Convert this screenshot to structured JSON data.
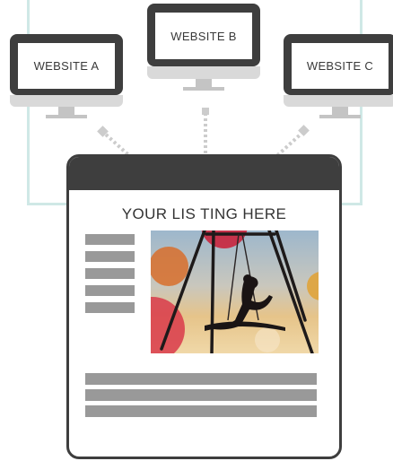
{
  "websites": [
    {
      "label": "WEBSITE A"
    },
    {
      "label": "WEBSITE B"
    },
    {
      "label": "WEBSITE C"
    }
  ],
  "listing": {
    "title": "YOUR LIS TING HERE"
  },
  "colors": {
    "frame": "#cfe8e6",
    "monitor": "#3e3e3e",
    "placeholder": "#999999",
    "connector": "#cccccc"
  }
}
